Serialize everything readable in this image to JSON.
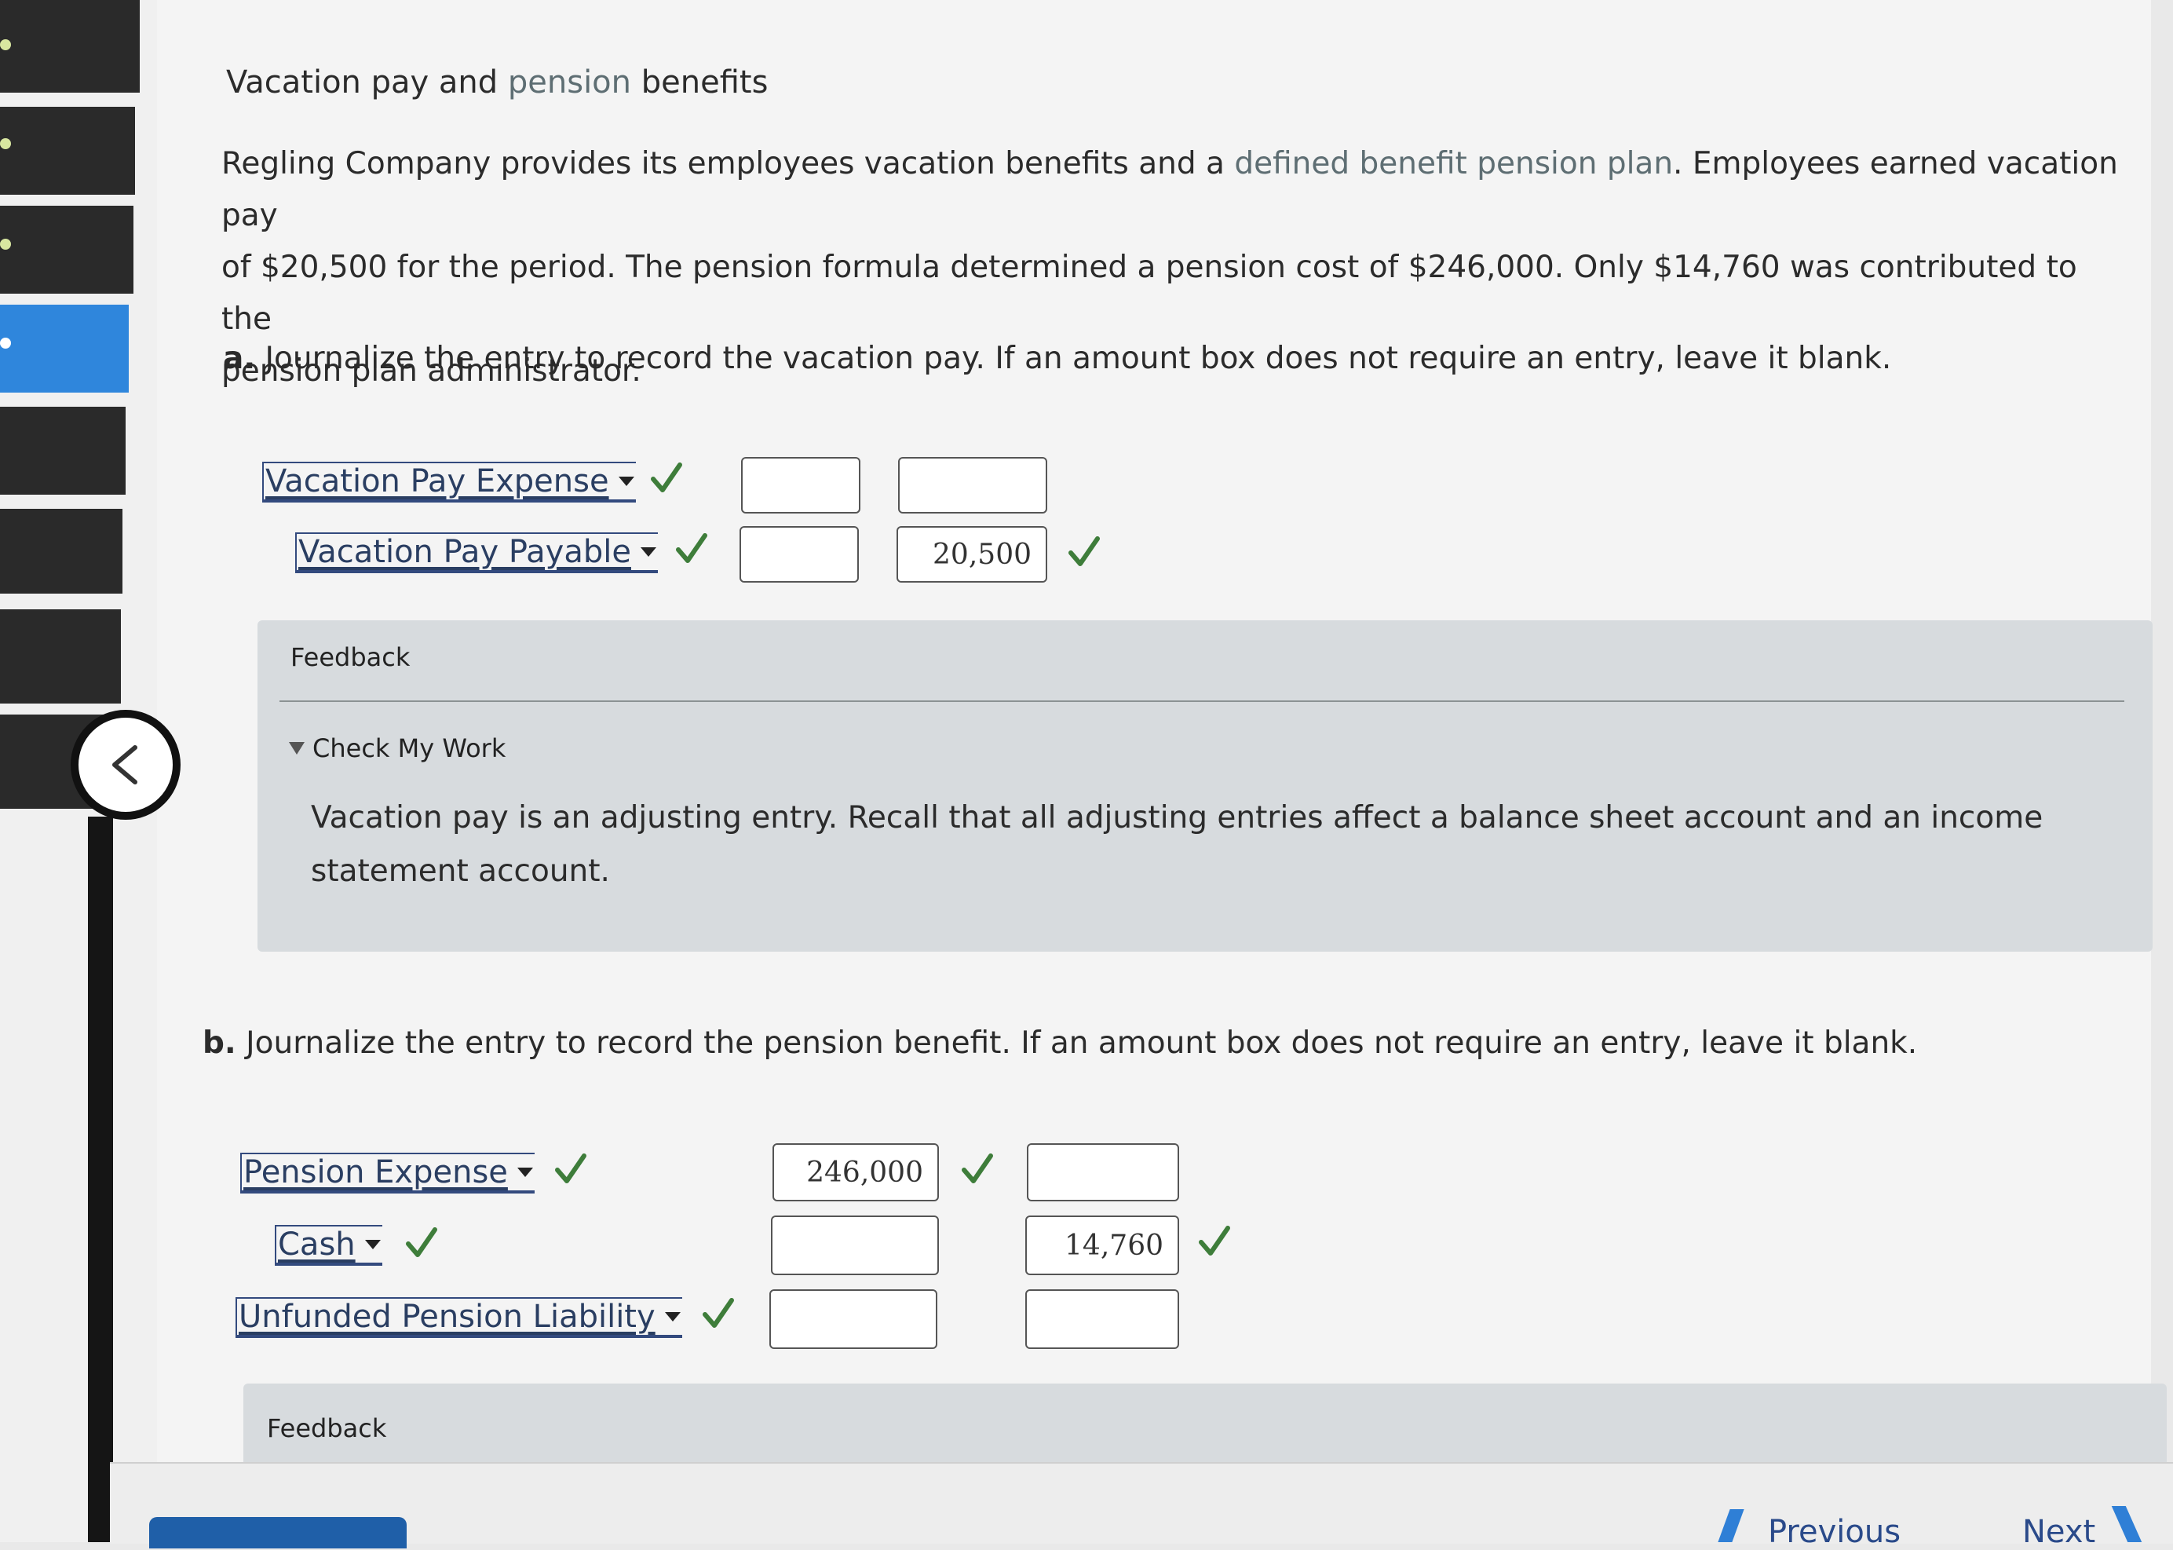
{
  "title": {
    "part1": "Vacation pay and ",
    "part2": "pension",
    "part3": " benefits"
  },
  "intro": {
    "line1_a": "Regling Company provides its employees vacation benefits and a ",
    "line1_b": "defined benefit pension plan",
    "line1_c": ". Employees earned vacation pay",
    "line2": "of $20,500 for the period. The pension formula determined a pension cost of $246,000. Only $14,760 was contributed to the",
    "line3": "pension plan administrator."
  },
  "part_a": {
    "label": "a.",
    "question": " Journalize the entry to record the vacation pay. If an amount box does not require an entry, leave it blank.",
    "rows": [
      {
        "account": "Vacation Pay Expense",
        "debit": "",
        "credit": ""
      },
      {
        "account": "Vacation Pay Payable",
        "debit": "",
        "credit": "20,500"
      }
    ],
    "feedback": {
      "label": "Feedback",
      "toggle": "Check My Work",
      "line1": "Vacation pay is an adjusting entry. Recall that all adjusting entries affect a balance sheet account and an income",
      "line2": "statement account."
    }
  },
  "part_b": {
    "label": "b.",
    "question": " Journalize the entry to record the pension benefit. If an amount box does not require an entry, leave it blank.",
    "rows": [
      {
        "account": "Pension Expense",
        "debit": "246,000",
        "credit": ""
      },
      {
        "account": "Cash",
        "debit": "",
        "credit": "14,760"
      },
      {
        "account": "Unfunded Pension Liability",
        "debit": "",
        "credit": ""
      }
    ],
    "feedback": {
      "label": "Feedback"
    }
  },
  "nav": {
    "previous": "Previous",
    "next": "Next"
  },
  "colors": {
    "check": "#3e7d3a",
    "link_blue": "#2a3e62",
    "feedback_bg": "#d7dbde",
    "active_tab": "#2f86dc"
  },
  "icons": [
    "check-icon",
    "chevron-left-icon",
    "caret-down-icon"
  ]
}
